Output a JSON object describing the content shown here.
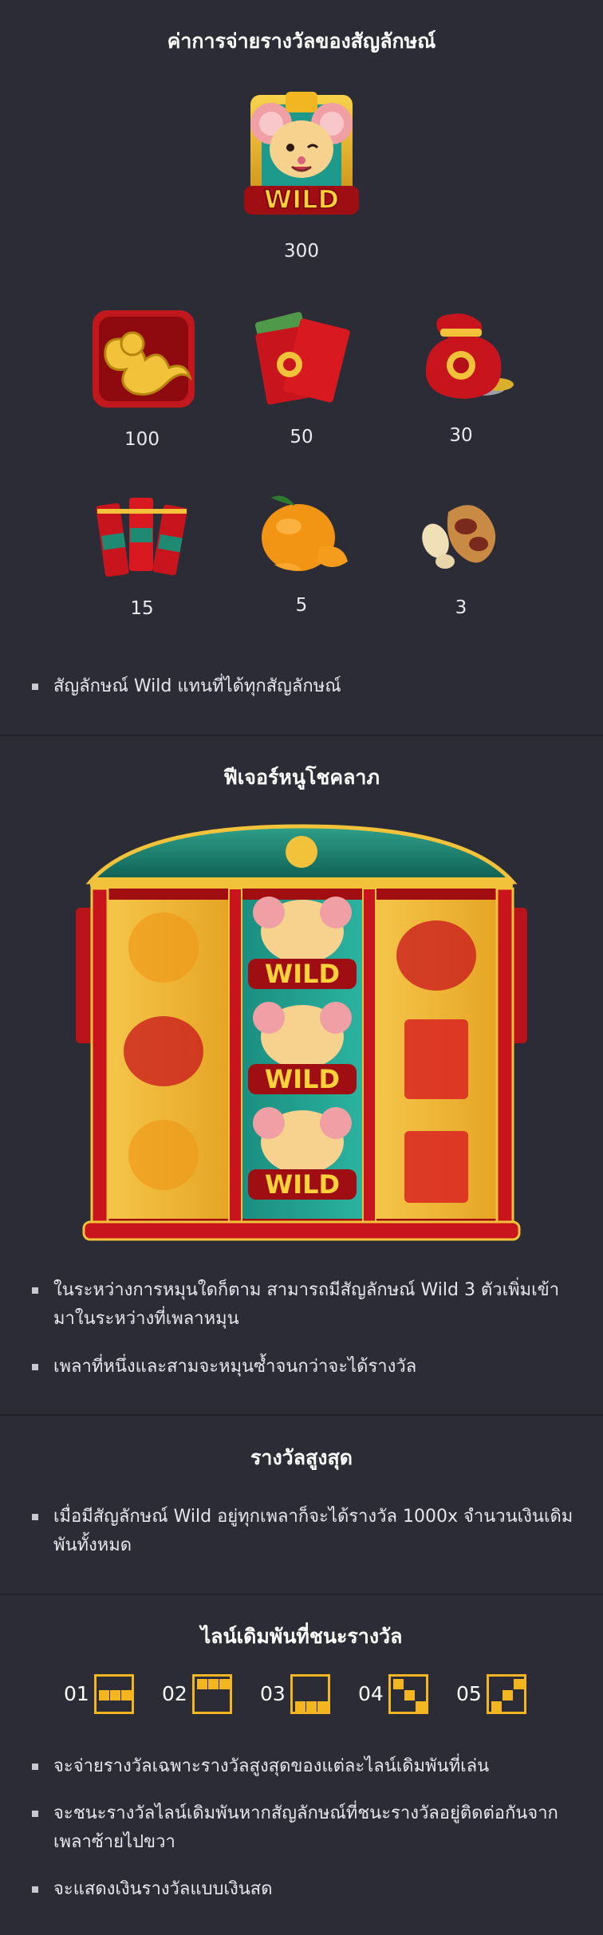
{
  "paytable": {
    "title": "ค่าการจ่ายรางวัลของสัญลักษณ์",
    "wild": {
      "icon": "wild-mouse-icon",
      "label": "WILD",
      "payout": "300"
    },
    "symbols": [
      {
        "name": "gold-mouse-emblem",
        "payout": "100"
      },
      {
        "name": "red-envelopes",
        "payout": "50"
      },
      {
        "name": "lucky-bag",
        "payout": "30"
      },
      {
        "name": "firecrackers",
        "payout": "15"
      },
      {
        "name": "orange",
        "payout": "5"
      },
      {
        "name": "peanuts",
        "payout": "3"
      }
    ],
    "note": "สัญลักษณ์ Wild แทนที่ได้ทุกสัญลักษณ์"
  },
  "feature": {
    "title": "ฟีเจอร์หนูโชคลาภ",
    "reel_wild_label": "WILD",
    "notes": [
      "ในระหว่างการหมุนใดก็ตาม สามารถมีสัญลักษณ์ Wild 3 ตัวเพิ่มเข้ามาในระหว่างที่เพลาหมุน",
      "เพลาที่หนึ่งและสามจะหมุนซ้ำจนกว่าจะได้รางวัล"
    ]
  },
  "max_win": {
    "title": "รางวัลสูงสุด",
    "note": "เมื่อมีสัญลักษณ์ Wild อยู่ทุกเพลาก็จะได้รางวัล 1000x จำนวนเงินเดิมพันทั้งหมด"
  },
  "paylines": {
    "title": "ไลน์เดิมพันที่ชนะรางวัล",
    "lines": [
      {
        "number": "01",
        "pattern": [
          2,
          2,
          2
        ]
      },
      {
        "number": "02",
        "pattern": [
          1,
          1,
          1
        ]
      },
      {
        "number": "03",
        "pattern": [
          3,
          3,
          3
        ]
      },
      {
        "number": "04",
        "pattern": [
          1,
          2,
          3
        ]
      },
      {
        "number": "05",
        "pattern": [
          3,
          2,
          1
        ]
      }
    ],
    "notes": [
      "จะจ่ายรางวัลเฉพาะรางวัลสูงสุดของแต่ละไลน์เดิมพันที่เล่น",
      "จะชนะรางวัลไลน์เดิมพันหากสัญลักษณ์ที่ชนะรางวัลอยู่ติดต่อกันจากเพลาซ้ายไปขวา",
      "จะแสดงเงินรางวัลแบบเงินสด"
    ]
  },
  "colors": {
    "background": "#2c2c37",
    "accent": "#f4b620",
    "divider": "#23232c"
  }
}
